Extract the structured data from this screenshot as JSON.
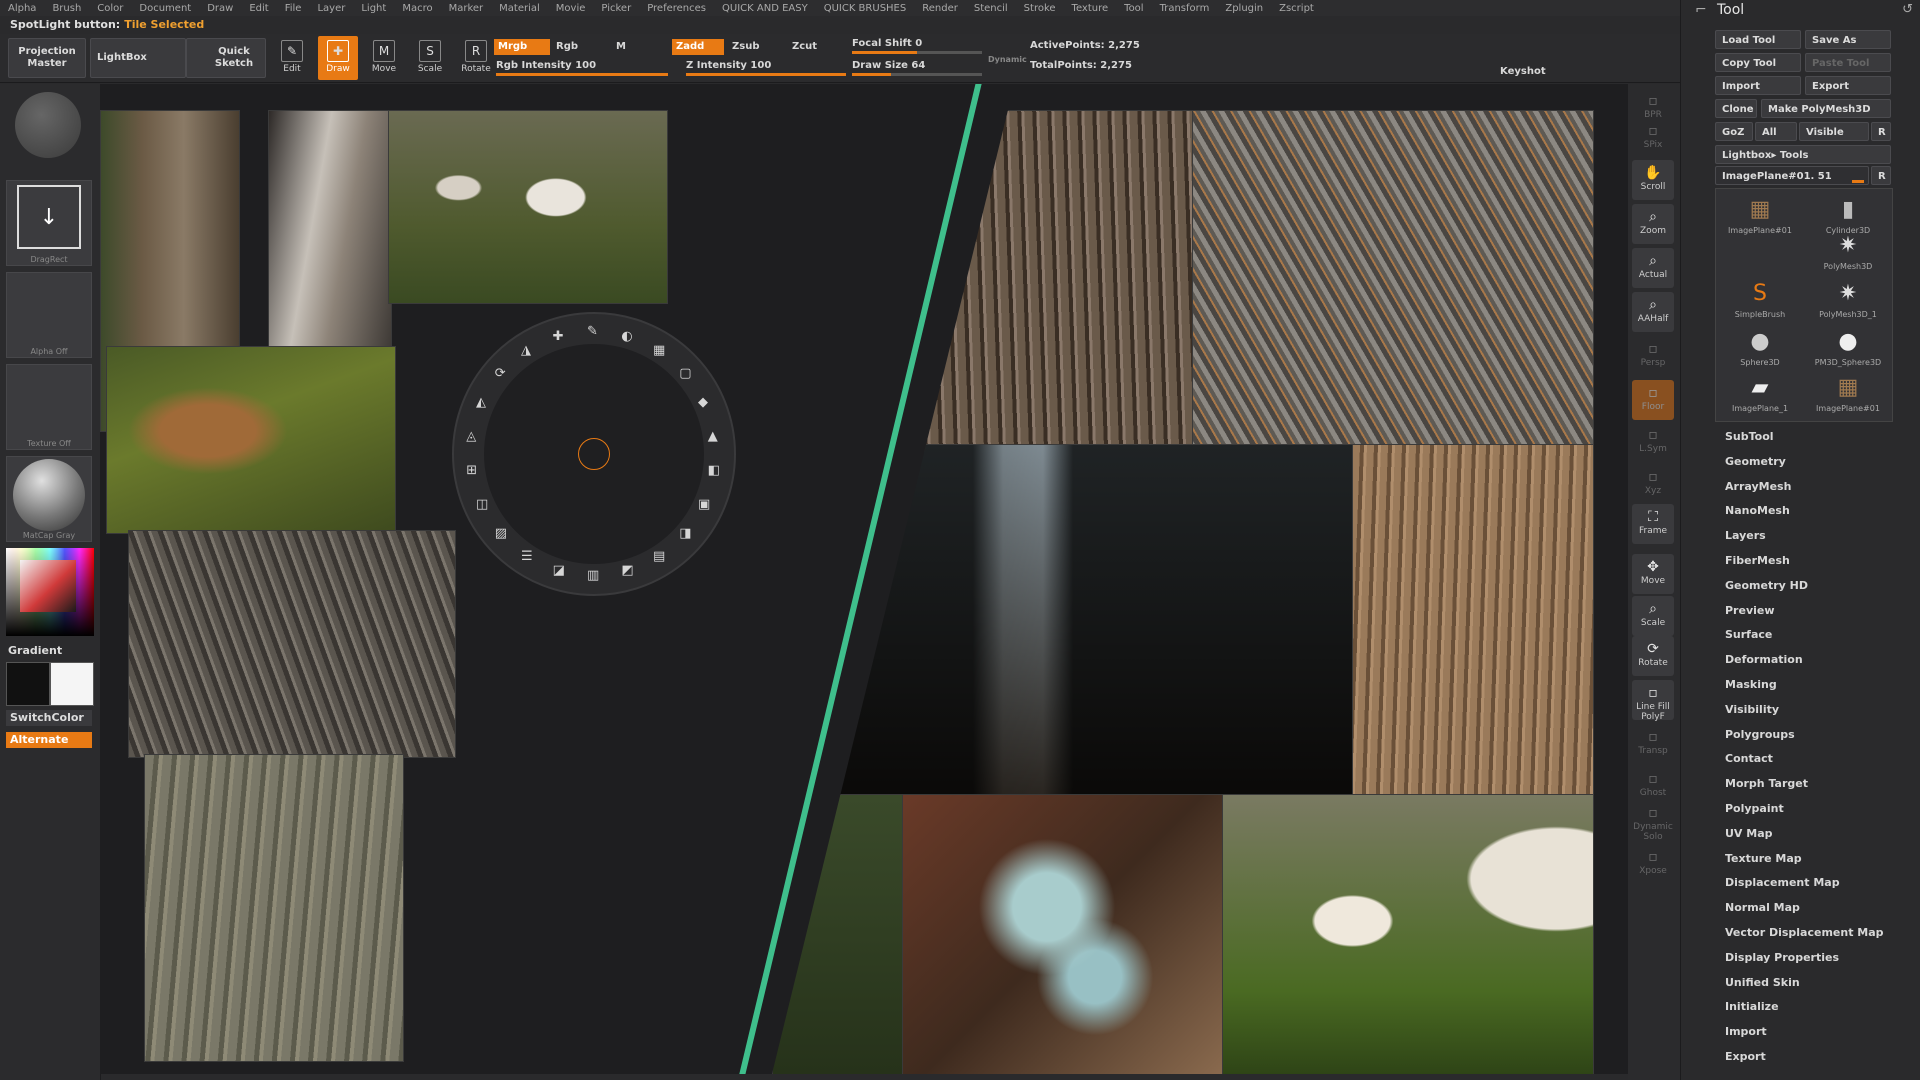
{
  "menu": [
    "Alpha",
    "Brush",
    "Color",
    "Document",
    "Draw",
    "Edit",
    "File",
    "Layer",
    "Light",
    "Macro",
    "Marker",
    "Material",
    "Movie",
    "Picker",
    "Preferences",
    "QUICK AND EASY",
    "QUICK BRUSHES",
    "Render",
    "Stencil",
    "Stroke",
    "Texture",
    "Tool",
    "Transform",
    "Zplugin",
    "Zscript"
  ],
  "spotlight": {
    "label": "SpotLight button:",
    "value": "Tile Selected"
  },
  "toolbar": {
    "projection_master": "Projection Master",
    "lightbox": "LightBox",
    "quick_sketch": "Quick Sketch",
    "tools": [
      {
        "label": "Edit",
        "icon": "edit-icon",
        "glyph": "✎"
      },
      {
        "label": "Draw",
        "icon": "draw-icon",
        "glyph": "✚"
      },
      {
        "label": "Move",
        "icon": "move-icon",
        "glyph": "M"
      },
      {
        "label": "Scale",
        "icon": "scale-icon",
        "glyph": "S"
      },
      {
        "label": "Rotate",
        "icon": "rotate-icon",
        "glyph": "R"
      }
    ],
    "mrgb": "Mrgb",
    "rgb": "Rgb",
    "m": "M",
    "zadd": "Zadd",
    "zsub": "Zsub",
    "zcut": "Zcut",
    "rgb_intensity_label": "Rgb Intensity",
    "rgb_intensity": "100",
    "z_intensity_label": "Z Intensity",
    "z_intensity": "100",
    "focal_shift_label": "Focal Shift",
    "focal_shift": "0",
    "draw_size_label": "Draw Size",
    "draw_size": "64",
    "dynamic": "Dynamic",
    "active_points_label": "ActivePoints:",
    "active_points": "2,275",
    "total_points_label": "TotalPoints:",
    "total_points": "2,275",
    "keyshot": "Keyshot"
  },
  "left_tray": {
    "drag_rect": "DragRect",
    "alpha_off": "Alpha Off",
    "texture_off": "Texture Off",
    "matcap": "MatCap Gray",
    "gradient": "Gradient",
    "switch_color": "SwitchColor",
    "alternate": "Alternate"
  },
  "shelf": [
    "BPR",
    "SPix",
    "Scroll",
    "Zoom",
    "Actual",
    "AAHalf",
    "Persp",
    "Floor",
    "L.Sym",
    "Xyz",
    "Frame",
    "Move",
    "Scale",
    "Rotate",
    "Line Fill PolyF",
    "Transp",
    "Ghost",
    "Dynamic Solo",
    "Xpose"
  ],
  "tool_panel": {
    "title": "Tool",
    "load_tool": "Load Tool",
    "save_as": "Save As",
    "copy_tool": "Copy Tool",
    "paste_tool": "Paste Tool",
    "import": "Import",
    "export": "Export",
    "clone": "Clone",
    "make_polymesh": "Make PolyMesh3D",
    "goz": "GoZ",
    "all": "All",
    "visible": "Visible",
    "r": "R",
    "lightbox_tools": "Lightbox▸ Tools",
    "current_tool": "ImagePlane#01. 51",
    "thumbs": [
      "ImagePlane#01",
      "Cylinder3D",
      "SimpleBrush",
      "PolyMesh3D",
      "Sphere3D",
      "PolyMesh3D_1",
      "ImagePlane_1",
      "PM3D_Sphere3D",
      "ImagePlane#01"
    ],
    "menu": [
      "SubTool",
      "Geometry",
      "ArrayMesh",
      "NanoMesh",
      "Layers",
      "FiberMesh",
      "Geometry HD",
      "Preview",
      "Surface",
      "Deformation",
      "Masking",
      "Visibility",
      "Polygroups",
      "Contact",
      "Morph Target",
      "Polypaint",
      "UV Map",
      "Texture Map",
      "Displacement Map",
      "Normal Map",
      "Vector Displacement Map",
      "Display Properties",
      "Unified Skin",
      "Initialize",
      "Import",
      "Export"
    ]
  },
  "colors": {
    "accent": "#e87a14",
    "divider": "#3fbf8c"
  }
}
